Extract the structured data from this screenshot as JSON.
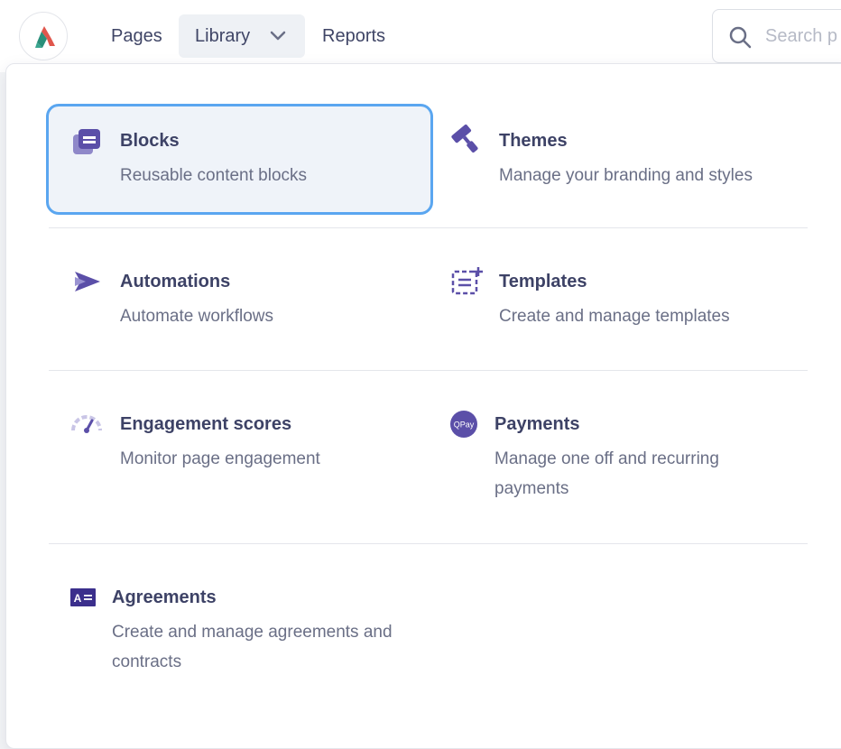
{
  "nav": {
    "items": [
      {
        "label": "Pages"
      },
      {
        "label": "Library"
      },
      {
        "label": "Reports"
      }
    ],
    "search_placeholder": "Search p"
  },
  "menu": {
    "items": [
      {
        "title": "Blocks",
        "description": "Reusable content blocks",
        "icon": "blocks-icon"
      },
      {
        "title": "Themes",
        "description": "Manage your branding and styles",
        "icon": "paint-roller-icon"
      },
      {
        "title": "Automations",
        "description": "Automate workflows",
        "icon": "automation-icon"
      },
      {
        "title": "Templates",
        "description": "Create and manage templates",
        "icon": "template-icon"
      },
      {
        "title": "Engagement scores",
        "description": "Monitor page engagement",
        "icon": "gauge-icon"
      },
      {
        "title": "Payments",
        "description": "Manage one off and recurring payments",
        "icon": "qpay-icon",
        "icon_text": "QPay"
      },
      {
        "title": "Agreements",
        "description": "Create and manage agreements and contracts",
        "icon": "agreement-icon"
      }
    ]
  },
  "colors": {
    "accent": "#5aa6f0",
    "icon_purple": "#5b4fa8",
    "text_primary": "#3d4266",
    "text_secondary": "#6a6f86"
  }
}
